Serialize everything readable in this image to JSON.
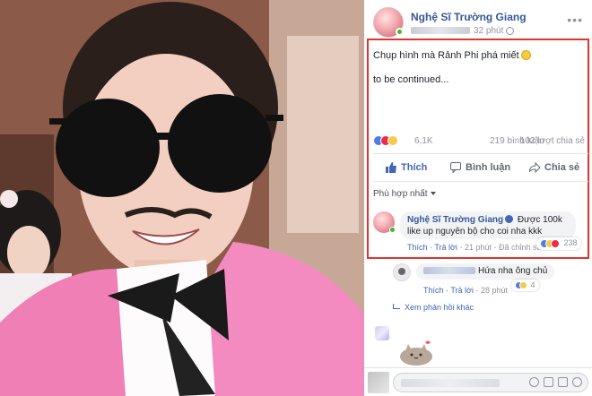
{
  "post": {
    "author": "Nghệ Sĩ Trường Giang",
    "time": "32 phút",
    "text_line1": "Chụp hình mà Rảnh Phi phá miết",
    "text_line2": "to be continued...",
    "more_icon": "•••"
  },
  "stats": {
    "reactions": "6,1K",
    "comments": "219 bình luận",
    "shares": "102 lượt chia sẻ"
  },
  "actions": {
    "like": "Thích",
    "comment": "Bình luận",
    "share": "Chia sẻ"
  },
  "sort_label": "Phù hợp nhất",
  "comments": [
    {
      "author": "Nghệ Sĩ Trường Giang",
      "text": "Được 100k like up nguyên bộ cho coi nha kkk",
      "like": "Thích",
      "reply": "Trả lời",
      "time": "21 phút",
      "edited": "Đã chỉnh sửa",
      "reaction_count": "238"
    },
    {
      "text": "Hứa nha ông chủ",
      "like": "Thích",
      "reply": "Trả lời",
      "time": "28 phút",
      "reaction_count": "4"
    }
  ],
  "more_replies": "Xem phản hồi khác",
  "colors": {
    "link": "#365899",
    "accent": "#4267b2",
    "highlight_border": "#e0342d",
    "muted": "#90949c"
  },
  "icons": [
    "like-icon",
    "love-icon",
    "haha-icon",
    "comment-icon",
    "share-icon",
    "globe-icon",
    "verified-icon",
    "camera-icon",
    "emoji-icon",
    "gif-icon",
    "sticker-icon"
  ]
}
